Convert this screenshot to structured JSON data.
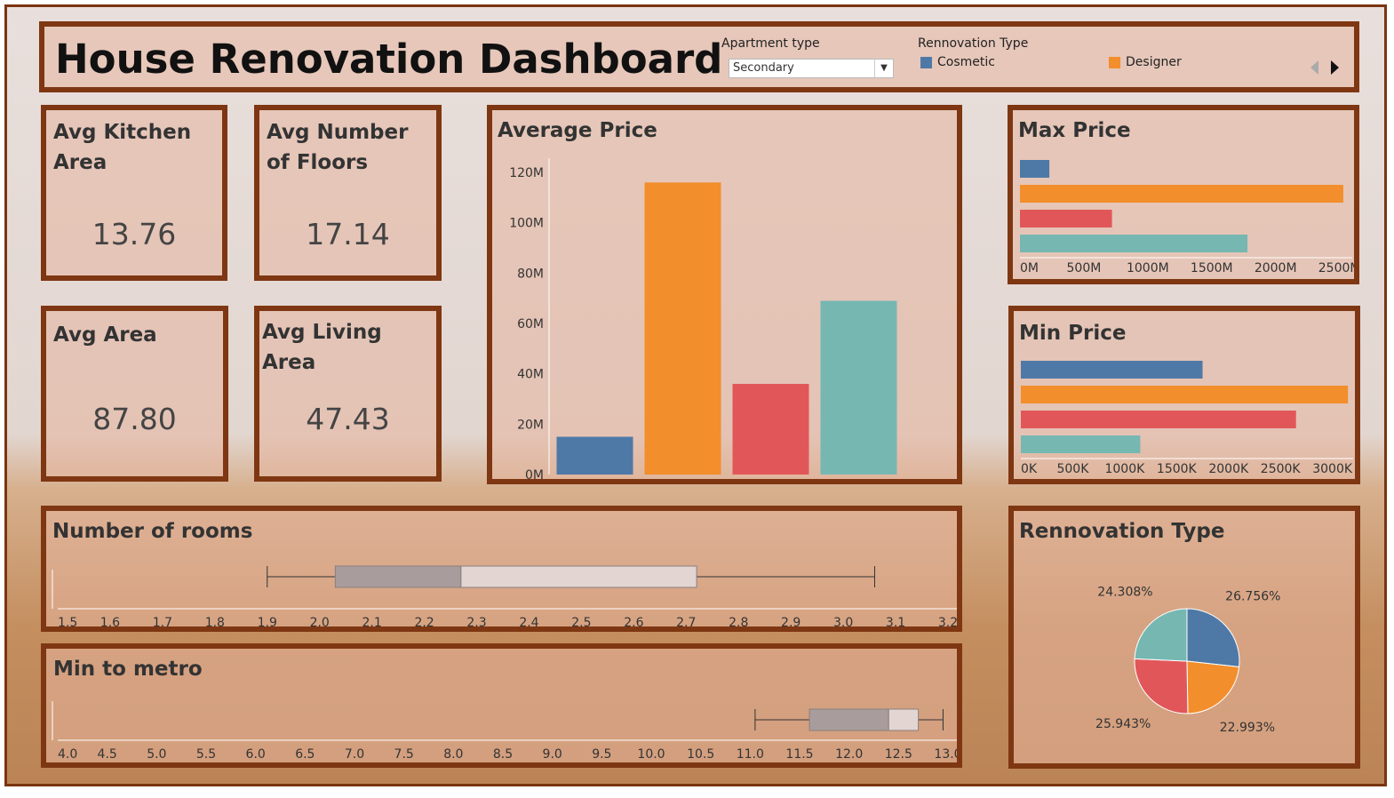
{
  "dashboard": {
    "title": "House Renovation Dashboard"
  },
  "filter": {
    "label": "Apartment type",
    "value": "Secondary"
  },
  "legend": {
    "title": "Rennovation Type",
    "items": [
      {
        "name": "Cosmetic",
        "color": "#4e79a7"
      },
      {
        "name": "Designer",
        "color": "#f28e2b"
      }
    ]
  },
  "colors": [
    "#4e79a7",
    "#f28e2b",
    "#e15759",
    "#76b7b2"
  ],
  "kpis": [
    {
      "label": "Avg Kitchen Area",
      "value": "13.76"
    },
    {
      "label": "Avg Number of Floors",
      "value": "17.14"
    },
    {
      "label": "Avg Area",
      "value": "87.80"
    },
    {
      "label": "Avg Living Area",
      "value": "47.43"
    }
  ],
  "chart_data": [
    {
      "type": "bar",
      "title": "Average Price",
      "values": [
        15000000,
        116000000,
        36000000,
        69000000
      ],
      "ylim": [
        0,
        120000000
      ],
      "yticks": [
        "0M",
        "20M",
        "40M",
        "60M",
        "80M",
        "100M",
        "120M"
      ],
      "colors": [
        "#4e79a7",
        "#f28e2b",
        "#e15759",
        "#76b7b2"
      ]
    },
    {
      "type": "bar",
      "orientation": "horizontal",
      "title": "Max Price",
      "values": [
        230000000,
        2530000000,
        720000000,
        1780000000
      ],
      "xlim": [
        0,
        2600000000
      ],
      "xticks": [
        "0M",
        "500M",
        "1000M",
        "1500M",
        "2000M",
        "2500M"
      ]
    },
    {
      "type": "bar",
      "orientation": "horizontal",
      "title": "Min Price",
      "values": [
        1750000,
        3150000,
        2650000,
        1150000
      ],
      "xlim": [
        0,
        3200000
      ],
      "xticks": [
        "0K",
        "500K",
        "1000K",
        "1500K",
        "2000K",
        "2500K",
        "3000K"
      ]
    },
    {
      "type": "boxplot",
      "title": "Number of rooms",
      "xlim": [
        1.5,
        3.2
      ],
      "whisker_low": 1.9,
      "q1": 2.03,
      "median": 2.27,
      "q3": 2.72,
      "whisker_high": 3.06,
      "xticks": [
        "1.5",
        "1.6",
        "1.7",
        "1.8",
        "1.9",
        "2.0",
        "2.1",
        "2.2",
        "2.3",
        "2.4",
        "2.5",
        "2.6",
        "2.7",
        "2.8",
        "2.9",
        "3.0",
        "3.1",
        "3.2"
      ]
    },
    {
      "type": "boxplot",
      "title": "Min to metro",
      "xlim": [
        4.0,
        13.0
      ],
      "whisker_low": 11.05,
      "q1": 11.6,
      "median": 12.4,
      "q3": 12.7,
      "whisker_high": 12.95,
      "xticks": [
        "4.0",
        "4.5",
        "5.0",
        "5.5",
        "6.0",
        "6.5",
        "7.0",
        "7.5",
        "8.0",
        "8.5",
        "9.0",
        "9.5",
        "10.0",
        "10.5",
        "11.0",
        "11.5",
        "12.0",
        "12.5",
        "13.0"
      ]
    },
    {
      "type": "pie",
      "title": "Rennovation Type",
      "values": [
        26.756,
        22.993,
        25.943,
        24.308
      ],
      "labels": [
        "26.756%",
        "22.993%",
        "25.943%",
        "24.308%"
      ],
      "colors": [
        "#4e79a7",
        "#f28e2b",
        "#e15759",
        "#76b7b2"
      ]
    }
  ]
}
